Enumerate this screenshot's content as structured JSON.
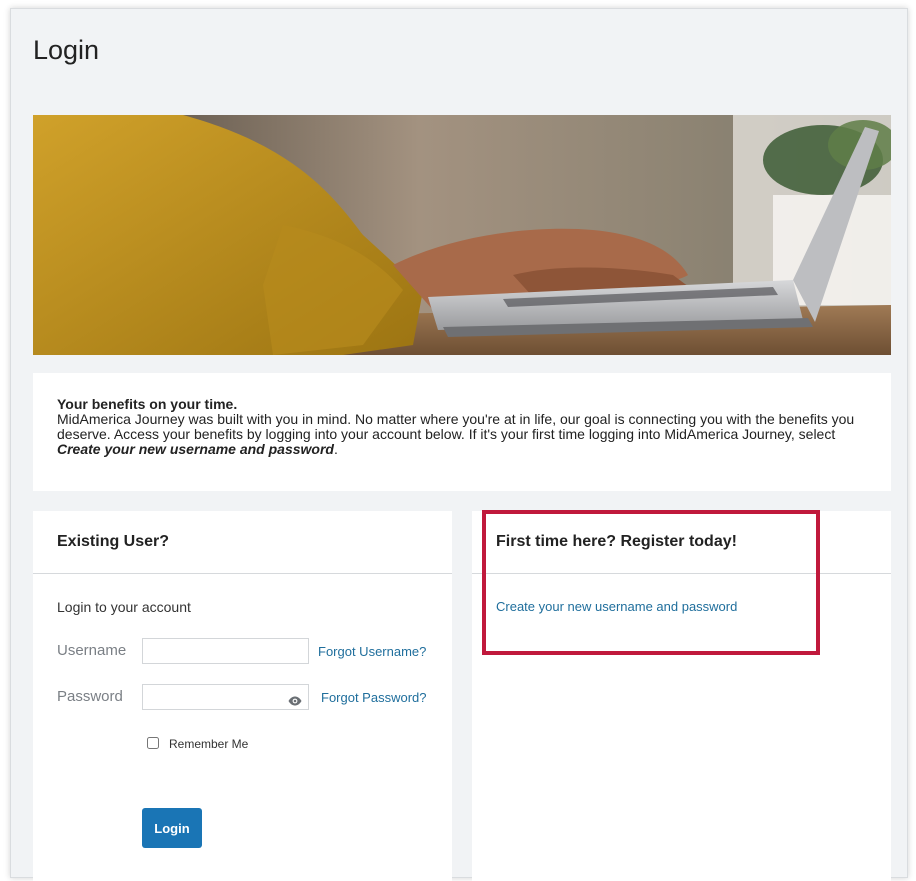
{
  "page": {
    "title": "Login"
  },
  "benefits": {
    "heading": "Your benefits on your time.",
    "text_before": "MidAmerica Journey was built with you in mind. No matter where you're at in life, our goal is connecting you with the benefits you deserve. Access your benefits by logging into your account below. If it's your first time logging into MidAmerica Journey, select ",
    "emphasis": "Create your new username and password",
    "text_after": "."
  },
  "existing_user": {
    "heading": "Existing User?",
    "subtitle": "Login to your account",
    "username_label": "Username",
    "username_value": "",
    "password_label": "Password",
    "password_value": "",
    "forgot_username": "Forgot Username?",
    "forgot_password": "Forgot Password?",
    "remember_me": "Remember Me",
    "login_button": "Login"
  },
  "register": {
    "heading": "First time here? Register today!",
    "create_link": "Create your new username and password"
  },
  "colors": {
    "accent": "#1a75b5",
    "link": "#1f6e9c",
    "highlight": "#c0193c",
    "page_background": "#f1f3f5"
  },
  "icons": {
    "password_toggle": "eye-icon",
    "hero": "hero-image-laptop-typing"
  }
}
